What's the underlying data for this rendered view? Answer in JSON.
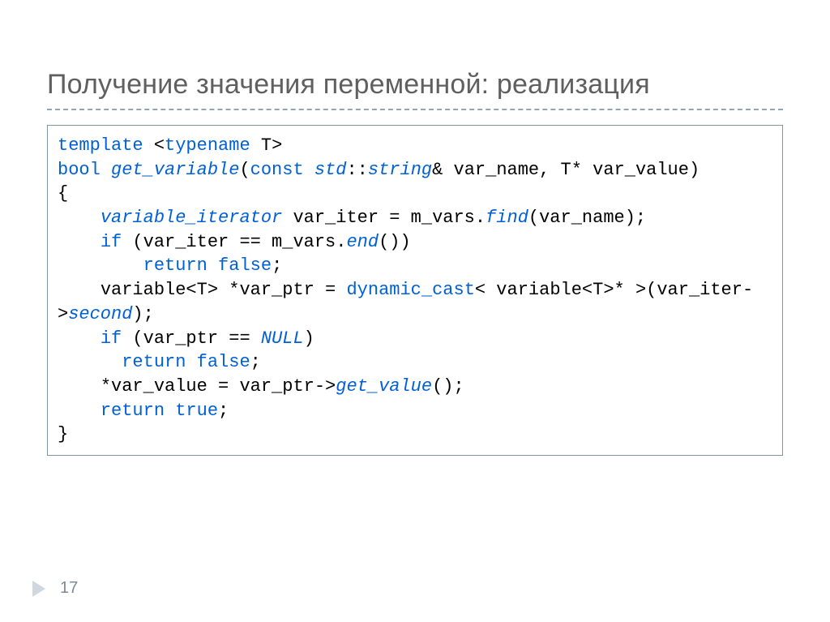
{
  "title": "Получение значения переменной: реализация",
  "page_number": "17",
  "code": {
    "l1_template": "template",
    "l1_typename": "typename",
    "l1_T": "T",
    "l2_bool": "bool",
    "l2_get_variable": "get_variable",
    "l2_const": "const",
    "l2_std": "std",
    "l2_string": "string",
    "l2_rest": "& var_name, T* var_value)",
    "l3": "{",
    "l4_variable_iterator": "variable_iterator",
    "l4_mid": " var_iter = m_vars.",
    "l4_find": "find",
    "l4_tail": "(var_name);",
    "l5_if": "if",
    "l5_mid": " (var_iter == m_vars.",
    "l5_end": "end",
    "l5_tail": "())",
    "l6_return": "return",
    "l6_false": "false",
    "l7_prefix": "    variable<T> *var_ptr = ",
    "l7_dynamic_cast": "dynamic_cast",
    "l7_tail": "< variable<T>* >(var_iter->",
    "l7_second": "second",
    "l7_close": ");",
    "l8_if": "if",
    "l8_mid": " (var_ptr == ",
    "l8_null": "NULL",
    "l8_tail": ")",
    "l9_return": "return",
    "l9_false": "false",
    "l10_prefix": "    *var_value = var_ptr->",
    "l10_get_value": "get_value",
    "l10_tail": "();",
    "l11_return": "return",
    "l11_true": "true",
    "l12": "}"
  }
}
